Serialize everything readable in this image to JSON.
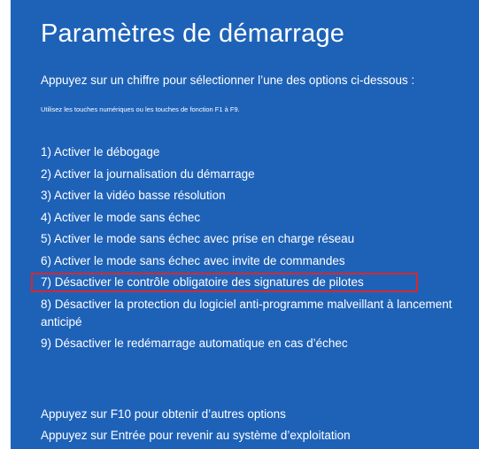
{
  "header": {
    "title": "Paramètres de démarrage",
    "subtitle": "Appuyez sur un chiffre pour sélectionner l’une des options ci-dessous :",
    "hint": "Utilisez les touches numériques ou les touches de fonction F1 à F9."
  },
  "options": [
    {
      "label": "1) Activer le débogage"
    },
    {
      "label": "2) Activer la journalisation du démarrage"
    },
    {
      "label": "3) Activer la vidéo basse résolution"
    },
    {
      "label": "4) Activer le mode sans échec"
    },
    {
      "label": "5) Activer le mode sans échec avec prise en charge réseau"
    },
    {
      "label": "6) Activer le mode sans échec avec invite de commandes"
    },
    {
      "label": "7) Désactiver le contrôle obligatoire des signatures de pilotes",
      "highlighted": true
    },
    {
      "label": "8) Désactiver la protection du logiciel anti-programme malveillant à lancement anticipé"
    },
    {
      "label": "9) Désactiver le redémarrage automatique en cas d’échec"
    }
  ],
  "footer": {
    "more_options": "Appuyez sur F10 pour obtenir d’autres options",
    "return": "Appuyez sur Entrée pour revenir au système d’exploitation"
  },
  "colors": {
    "background": "#1e62b8",
    "text": "#ffffff",
    "highlight_border": "#d9262e"
  }
}
